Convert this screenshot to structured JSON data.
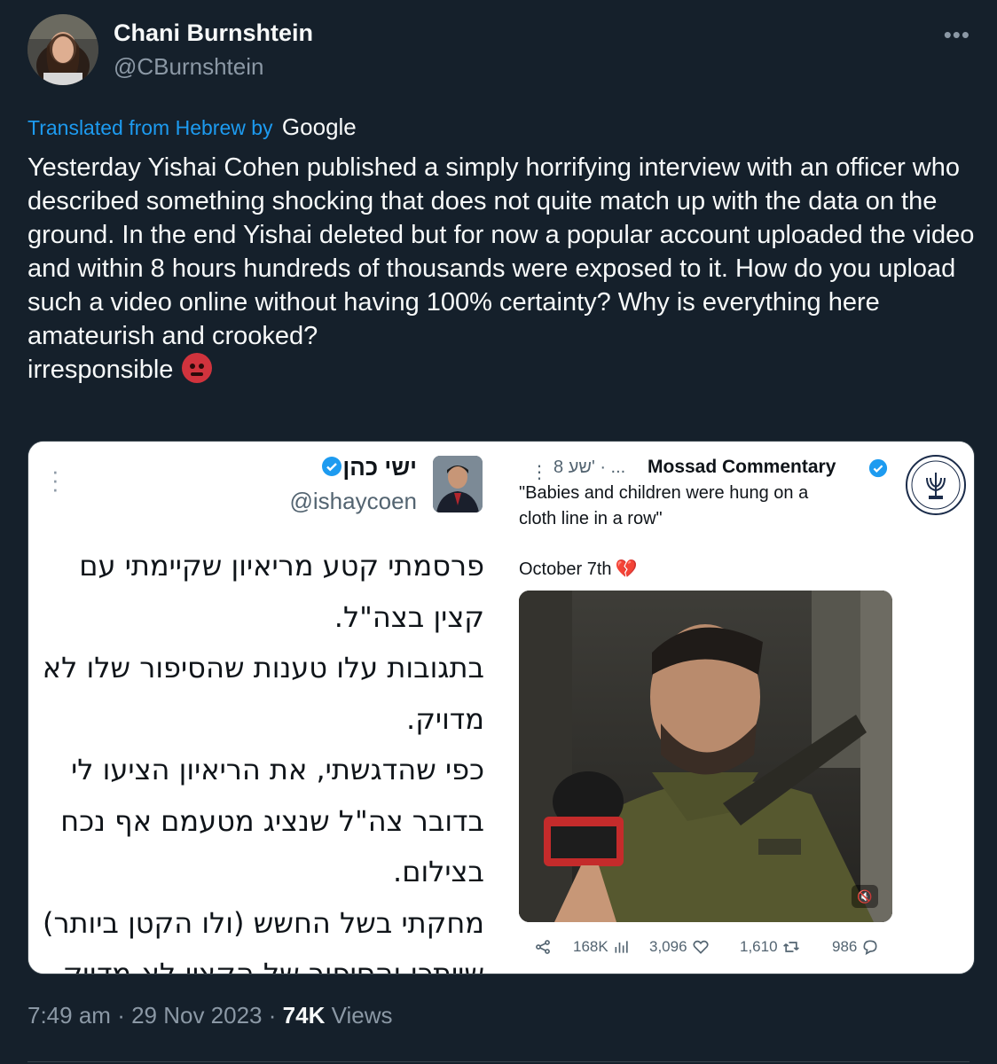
{
  "author": {
    "name": "Chani Burnshtein",
    "handle": "@CBurnshtein"
  },
  "translation": {
    "prefix": "Translated from Hebrew by",
    "brand": "Google"
  },
  "tweet": {
    "text": "Yesterday Yishai Cohen published a simply horrifying interview with an officer who described something shocking that does not quite match up with the data on the ground. In the end Yishai deleted but for now a popular account uploaded the video and within 8 hours hundreds of thousands were exposed to it. How do you upload such a video online without having 100% certainty? Why is everything here amateurish and crooked?\nirresponsible",
    "emoji": "angry-face"
  },
  "embedded_left": {
    "name": "ישי כהן",
    "handle": "@ishaycoen",
    "text": "פרסמתי קטע מריאיון שקיימתי עם קצין בצה\"ל.\nבתגובות עלו טענות שהסיפור שלו לא מדויק.\nכפי שהדגשתי, את הריאיון הציעו לי בדובר צה\"ל שנציג מטעמם אף נכח בצילום.\nמחקתי בשל החשש (ולו הקטן ביותר) שייתכן והסיפור של הקצין לא מדויק והדבר יגרום לנזק להסברה."
  },
  "embedded_right": {
    "account": "Mossad Commentary",
    "time": "8 שע' · ...",
    "quote": "\"Babies and children were hung on a\ncloth line in a row\"",
    "date_label": "October 7th",
    "stats": {
      "views": "168K",
      "likes": "3,096",
      "retweets": "1,610",
      "replies": "986"
    }
  },
  "footer": {
    "time": "7:49 am",
    "date": "29 Nov 2023",
    "views_count": "74K",
    "views_label": "Views"
  },
  "colors": {
    "background": "#15202b",
    "link": "#1d9bf0",
    "muted": "#8b98a5",
    "verified": "#1d9bf0",
    "angry": "#d0333d"
  }
}
